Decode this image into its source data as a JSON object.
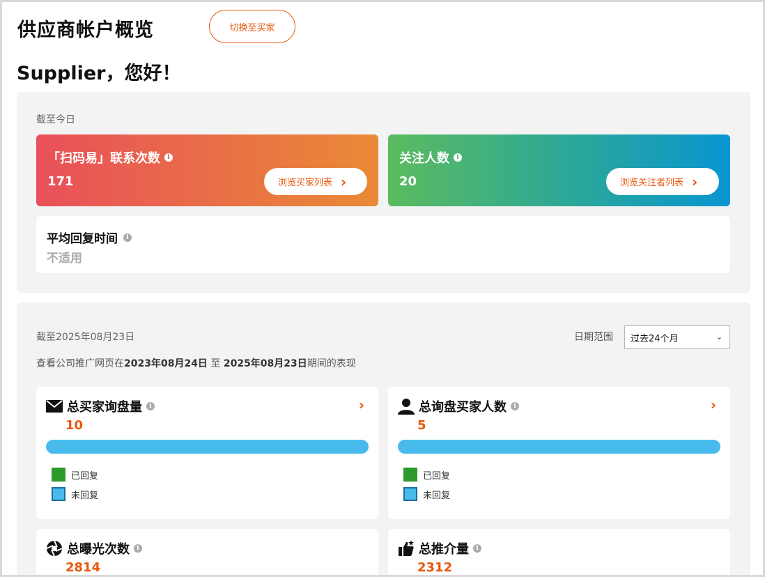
{
  "header": {
    "title": "供应商帐户概览",
    "switch_button": "切换至买家",
    "greeting": "Supplier，您好！"
  },
  "summary": {
    "asof": "截至今日",
    "contacts": {
      "label": "「扫码易」联系次数",
      "value": "171",
      "button": "浏览买家列表"
    },
    "followers": {
      "label": "关注人数",
      "value": "20",
      "button": "浏览关注者列表"
    },
    "reply_time": {
      "label": "平均回复时间",
      "value": "不适用"
    }
  },
  "performance": {
    "asof": "截至2025年08月23日",
    "period_prefix": "查看公司推广网页在",
    "period_start": "2023年08月24日",
    "period_mid": " 至 ",
    "period_end": "2025年08月23日",
    "period_suffix": "期间的表现",
    "range_label": "日期范围",
    "range_value": "过去24个月",
    "inquiries": {
      "label": "总买家询盘量",
      "value": "10",
      "replied_fraction": 0,
      "legend_replied": "已回复",
      "legend_unreplied": "未回复"
    },
    "inquiry_buyers": {
      "label": "总询盘买家人数",
      "value": "5",
      "replied_fraction": 0,
      "legend_replied": "已回复",
      "legend_unreplied": "未回复"
    },
    "exposure": {
      "label": "总曝光次数",
      "value": "2814"
    },
    "recommendations": {
      "label": "总推介量",
      "value": "2312"
    }
  },
  "colors": {
    "accent": "#e8580c",
    "replied": "#2e9a2b",
    "unreplied": "#47bbec"
  }
}
